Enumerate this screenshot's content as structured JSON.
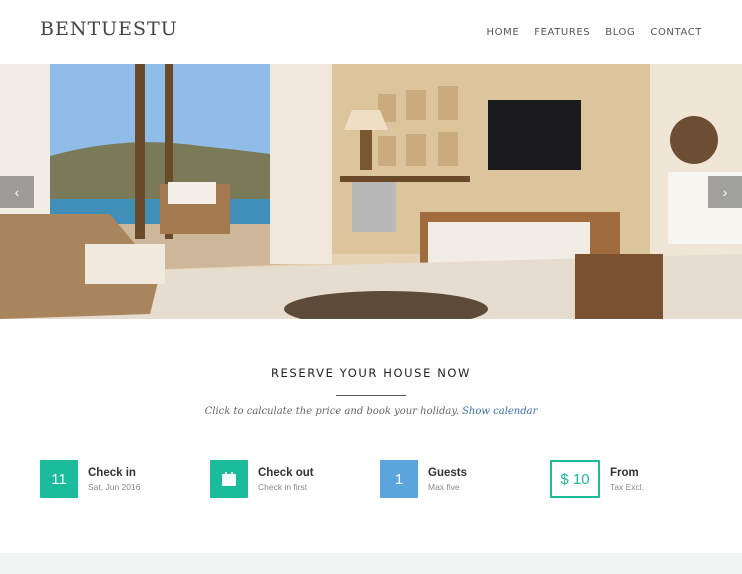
{
  "header": {
    "logo": "BENTUESTU",
    "nav": [
      "HOME",
      "FEATURES",
      "BLOG",
      "CONTACT"
    ]
  },
  "slider": {
    "prev_icon": "chevron-left-icon",
    "next_icon": "chevron-right-icon",
    "prev_symbol": "‹",
    "next_symbol": "›"
  },
  "reserve": {
    "title": "RESERVE YOUR HOUSE NOW",
    "subtitle": "Click to calculate the price and book your holiday.",
    "link": "Show calendar"
  },
  "booking": {
    "checkin": {
      "value": "11",
      "label": "Check in",
      "sub": "Sat, Jun 2016"
    },
    "checkout": {
      "icon": "calendar-icon",
      "label": "Check out",
      "sub": "Check in first"
    },
    "guests": {
      "value": "1",
      "label": "Guests",
      "sub": "Max five"
    },
    "price": {
      "value": "$ 10",
      "label": "From",
      "sub": "Tax Excl."
    }
  },
  "colors": {
    "teal": "#1abc9c",
    "blue": "#5aa6dc",
    "link": "#3a6fb0"
  }
}
